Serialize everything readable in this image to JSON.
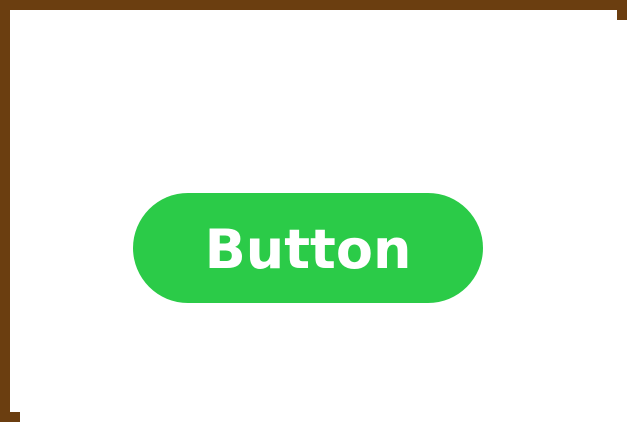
{
  "button": {
    "label": "Button",
    "background_color": "#2bcb48",
    "text_color": "#ffffff"
  },
  "frame": {
    "border_color": "#6b3e10",
    "background_color": "#ffffff"
  }
}
